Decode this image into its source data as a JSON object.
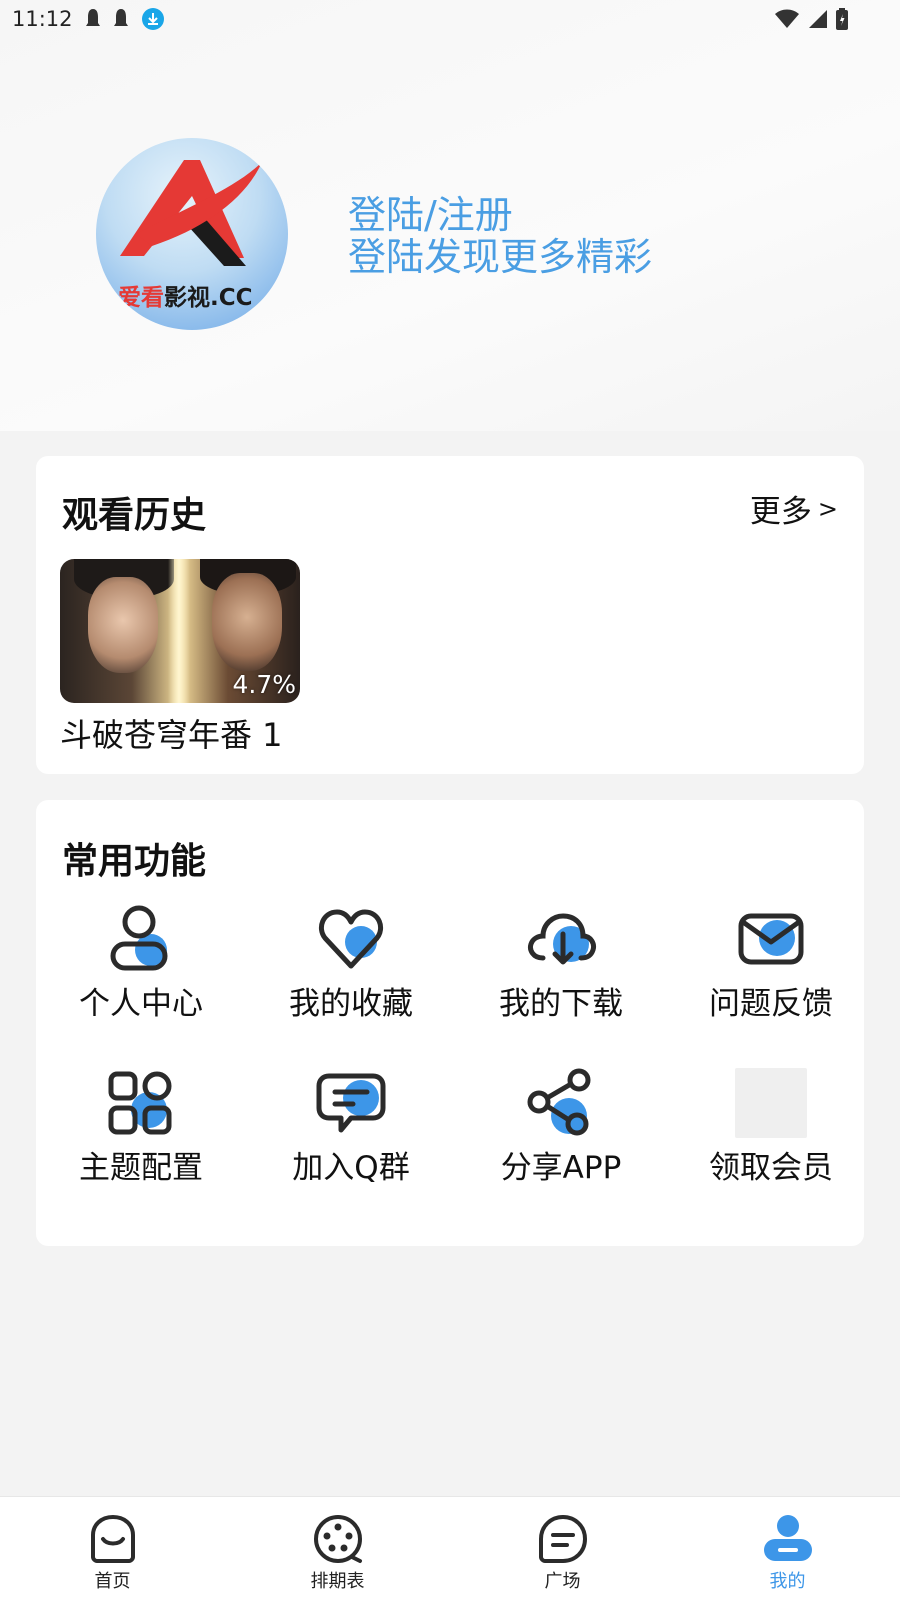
{
  "status_bar": {
    "time": "11:12"
  },
  "header": {
    "logo_text_red": "爱看",
    "logo_text_black": "影视.CC",
    "login_title": "登陆/注册",
    "login_subtitle": "登陆发现更多精彩"
  },
  "history": {
    "title": "观看历史",
    "more_label": "更多",
    "more_chevron": ">",
    "items": [
      {
        "name": "斗破苍穹年番 1",
        "progress": "4.7%"
      }
    ]
  },
  "functions": {
    "title": "常用功能",
    "items": [
      {
        "label": "个人中心",
        "icon": "user-icon"
      },
      {
        "label": "我的收藏",
        "icon": "heart-icon"
      },
      {
        "label": "我的下载",
        "icon": "cloud-download-icon"
      },
      {
        "label": "问题反馈",
        "icon": "mail-icon"
      },
      {
        "label": "主题配置",
        "icon": "grid-icon"
      },
      {
        "label": "加入Q群",
        "icon": "chat-icon"
      },
      {
        "label": "分享APP",
        "icon": "share-icon"
      },
      {
        "label": "领取会员",
        "icon": "image-placeholder-icon"
      }
    ]
  },
  "bottom_nav": {
    "items": [
      {
        "label": "首页",
        "icon": "home-icon",
        "active": false
      },
      {
        "label": "排期表",
        "icon": "schedule-icon",
        "active": false
      },
      {
        "label": "广场",
        "icon": "square-icon",
        "active": false
      },
      {
        "label": "我的",
        "icon": "profile-icon",
        "active": true
      }
    ]
  },
  "colors": {
    "accent": "#3d96e8",
    "login_text": "#4a9ee3",
    "icon_dark": "#2b2b2b"
  }
}
